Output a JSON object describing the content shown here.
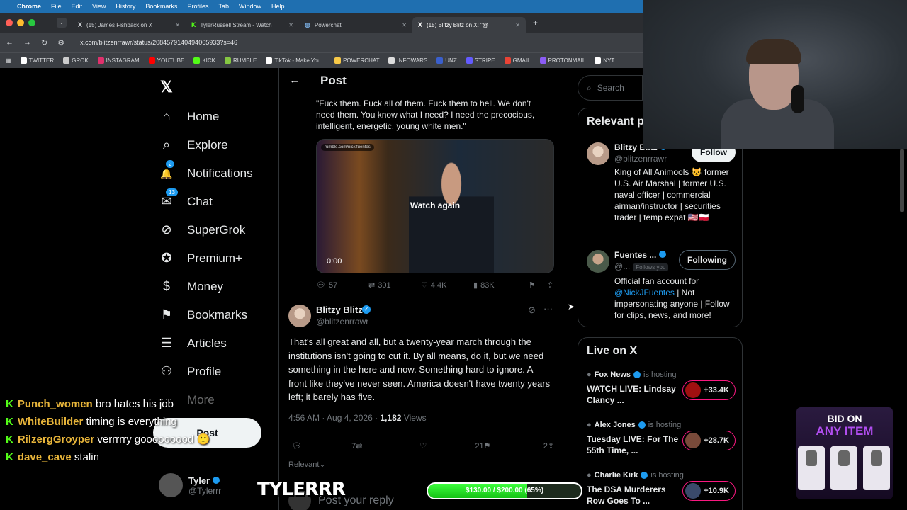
{
  "menubar": {
    "apple": "",
    "app": "Chrome",
    "items": [
      "File",
      "Edit",
      "View",
      "History",
      "Bookmarks",
      "Profiles",
      "Tab",
      "Window",
      "Help"
    ]
  },
  "tabs": [
    {
      "icon": "X",
      "title": "(15) James Fishback on X"
    },
    {
      "icon": "K",
      "title": "TylerRussell Stream - Watch"
    },
    {
      "icon": "◍",
      "title": "Powerchat"
    },
    {
      "icon": "X",
      "title": "(15) Blitzy Blitz on X: \"@"
    }
  ],
  "new_tab": "+",
  "address": {
    "url": "x.com/blitzenrrawr/status/2084579140494065933?s=46"
  },
  "bookmarks": [
    {
      "label": "TWITTER",
      "color": "#ffffff"
    },
    {
      "label": "GROK",
      "color": "#cccccc"
    },
    {
      "label": "INSTAGRAM",
      "color": "#e1306c"
    },
    {
      "label": "YOUTUBE",
      "color": "#ff0000"
    },
    {
      "label": "KICK",
      "color": "#53fc18"
    },
    {
      "label": "RUMBLE",
      "color": "#85c742"
    },
    {
      "label": "TikTok - Make You...",
      "color": "#ffffff"
    },
    {
      "label": "POWERCHAT",
      "color": "#f7c948"
    },
    {
      "label": "INFOWARS",
      "color": "#dddddd"
    },
    {
      "label": "UNZ",
      "color": "#3a5fcd"
    },
    {
      "label": "STRIPE",
      "color": "#635bff"
    },
    {
      "label": "GMAIL",
      "color": "#ea4335"
    },
    {
      "label": "PROTONMAIL",
      "color": "#8b5cf6"
    },
    {
      "label": "NYT",
      "color": "#ffffff"
    }
  ],
  "nav": {
    "logo": "𝕏",
    "items": [
      {
        "label": "Home",
        "icon": "⌂"
      },
      {
        "label": "Explore",
        "icon": "⌕"
      },
      {
        "label": "Notifications",
        "icon": "🔔",
        "badge": "2"
      },
      {
        "label": "Chat",
        "icon": "✉",
        "badge": "13"
      },
      {
        "label": "SuperGrok",
        "icon": "⊘"
      },
      {
        "label": "Premium+",
        "icon": "✪"
      },
      {
        "label": "Money",
        "icon": "$"
      },
      {
        "label": "Bookmarks",
        "icon": "⚑"
      },
      {
        "label": "Articles",
        "icon": "☰"
      },
      {
        "label": "Profile",
        "icon": "⚇"
      },
      {
        "label": "More",
        "icon": "⋯"
      }
    ],
    "post_button": "Post",
    "me": {
      "name": "Tyler",
      "handle": "@Tylerrr"
    }
  },
  "main": {
    "back": "←",
    "title": "Post",
    "quote": "\"Fuck them. Fuck all of them. Fuck them to hell. We don't need them. You know what I need? I need the precocious, intelligent, energetic, young white men.\"",
    "video": {
      "source": "rumble.com/nickjfuentes",
      "overlay": "Watch again",
      "time": "0:00"
    },
    "stats": {
      "replies": "57",
      "reposts": "301",
      "likes": "4.4K",
      "views": "83K"
    },
    "reply": {
      "name": "Blitzy Blitz",
      "handle": "@blitzenrrawr",
      "text": "That's all great and all, but a twenty-year march through the institutions isn't going to cut it. By all means, do it, but we need something in the here and now. Something hard to ignore. A front like they've never seen. America doesn't have twenty years left; it barely has five.",
      "time": "4:56 AM · Aug 4, 2026 · ",
      "views_count": "1,182",
      "views_label": " Views",
      "replies": "7",
      "likes": "21",
      "bookmarks": "2"
    },
    "sort": "Relevant",
    "reply_placeholder": "Post your reply"
  },
  "right": {
    "search_placeholder": "Search",
    "relevant_title": "Relevant p",
    "accounts": [
      {
        "name": "Blitzy Blitz",
        "handle": "@blitzenrrawr",
        "button": "Follow",
        "bio": "King of All Animools 😼 former U.S. Air Marshal | former U.S. naval officer | commercial airman/instructor | securities trader | temp expat 🇺🇸🇵🇱"
      },
      {
        "name": "Fuentes ...",
        "handle": "@...",
        "tag": "Follows you",
        "button": "Following",
        "bio_pre": "Official fan account for ",
        "bio_link": "@NickJFuentes",
        "bio_post": " | Not impersonating anyone | Follow for clips, news, and more!"
      }
    ],
    "live_title": "Live on X",
    "live": [
      {
        "host": "Fox News",
        "hosting": "is hosting",
        "title": "WATCH LIVE: Lindsay Clancy ...",
        "count": "+33.4K"
      },
      {
        "host": "Alex Jones",
        "hosting": "is hosting",
        "title": "Tuesday LIVE: For The 55th Time, ...",
        "count": "+28.7K"
      },
      {
        "host": "Charlie Kirk",
        "hosting": "is hosting",
        "title": "The DSA Murderers Row Goes To ...",
        "count": "+10.9K"
      }
    ]
  },
  "stream": {
    "chat": [
      {
        "user": "Punch_women",
        "message": "bro hates his job"
      },
      {
        "user": "WhiteBuilder",
        "message": "timing is everything"
      },
      {
        "user": "RilzergGroyper",
        "message": "verrrrry gooooooood 🙂"
      },
      {
        "user": "dave_cave",
        "message": "stalin"
      }
    ],
    "brand": "TYLERRR",
    "goal": {
      "text": "$130.00 / $200.00 (65%)",
      "progress": 0.65
    },
    "bid": {
      "line1": "BID ON",
      "line2": "ANY ITEM"
    }
  }
}
